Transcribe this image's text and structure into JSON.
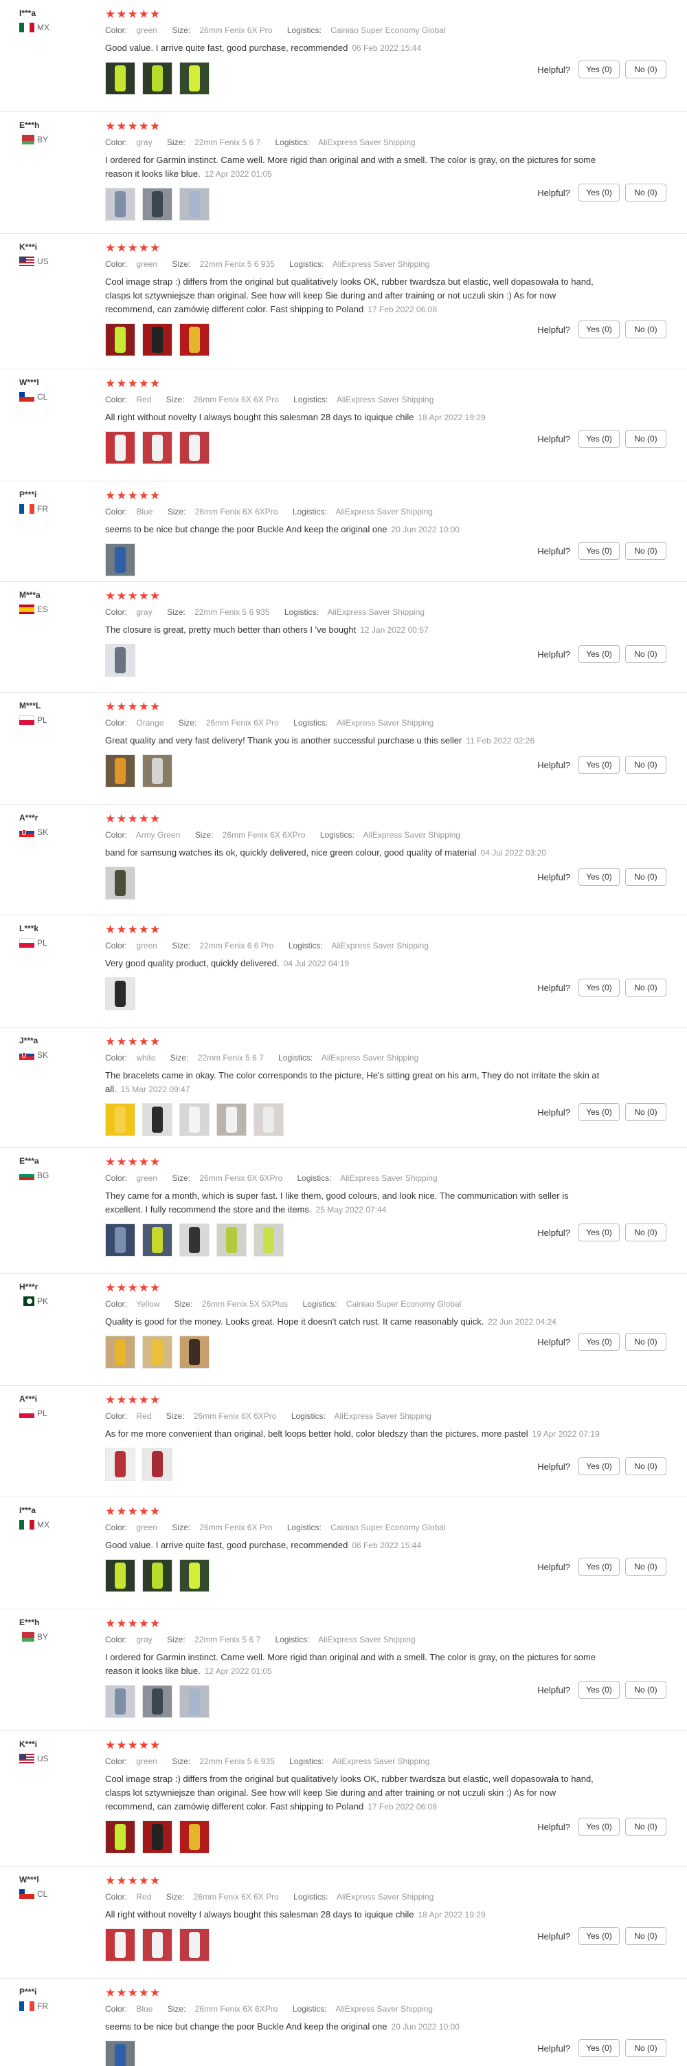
{
  "labels": {
    "color": "Color:",
    "size": "Size:",
    "logistics": "Logistics:",
    "helpful": "Helpful?",
    "yes": "Yes (0)",
    "no": "No (0)"
  },
  "reviews": [
    {
      "name": "I***a",
      "country": "MX",
      "stars": "★★★★★",
      "color": "green",
      "size": "26mm Fenix 6X Pro",
      "logistics": "Cainiao Super Economy Global",
      "text": "Good value. I arrive quite fast, good purchase, recommended",
      "date": "06 Feb 2022 15:44",
      "images": [
        "#2c3a28",
        "#2e3d27",
        "#334a2c"
      ],
      "image_fills": [
        "#c5e531",
        "#b8dc2b",
        "#d4ee3a"
      ]
    },
    {
      "name": "E***h",
      "country": "BY",
      "stars": "★★★★★",
      "color": "gray",
      "size": "22mm Fenix 5 6 7",
      "logistics": "AliExpress Saver Shipping",
      "text": "I ordered for Garmin instinct. Came well. More rigid than original and with a smell. The color is gray, on the pictures for some reason it looks like blue.",
      "date": "12 Apr 2022 01:05",
      "images": [
        "#c9ccd3",
        "#8b8f97",
        "#b7bcc6"
      ],
      "image_fills": [
        "#7d8ea6",
        "#3c4650",
        "#a4b5cc"
      ]
    },
    {
      "name": "K***i",
      "country": "US",
      "stars": "★★★★★",
      "color": "green",
      "size": "22mm Fenix 5 6 935",
      "logistics": "AliExpress Saver Shipping",
      "text": "Cool image strap :) differs from the original but qualitatively looks OK, rubber twardsza but elastic, well dopasowała to hand, clasps lot sztywniejsze than original. See how will keep Sie during and after training or not uczuli skin :) As for now recommend, can zamówię different color. Fast shipping to Poland",
      "date": "17 Feb 2022 06:08",
      "images": [
        "#8c1b1b",
        "#a01818",
        "#b31a1a"
      ],
      "image_fills": [
        "#c6ea2f",
        "#222222",
        "#e5b52a"
      ]
    },
    {
      "name": "W***l",
      "country": "CL",
      "stars": "★★★★★",
      "color": "Red",
      "size": "26mm Fenix 6X 6X Pro",
      "logistics": "AliExpress Saver Shipping",
      "text": "All right without novelty I always bought this salesman 28 days to iquique chile",
      "date": "18 Apr 2022 19:29",
      "images": [
        "#c4343c",
        "#c13a40",
        "#be3a42"
      ],
      "image_fills": [
        "#f2f2f2",
        "#f2f2f2",
        "#f2f2f2"
      ]
    },
    {
      "name": "P***i",
      "country": "FR",
      "stars": "★★★★★",
      "color": "Blue",
      "size": "26mm Fenix 6X 6XPro",
      "logistics": "AliExpress Saver Shipping",
      "text": "seems to be nice but change the poor Buckle And keep the original one",
      "date": "20 Jun 2022 10:00",
      "images": [
        "#6e7a84"
      ],
      "image_fills": [
        "#2f5fa8"
      ]
    },
    {
      "name": "M***a",
      "country": "ES",
      "stars": "★★★★★",
      "color": "gray",
      "size": "22mm Fenix 5 6 935",
      "logistics": "AliExpress Saver Shipping",
      "text": "The closure is great, pretty much better than others I 've bought",
      "date": "12 Jan 2022 00:57",
      "images": [
        "#dfe2e6"
      ],
      "image_fills": [
        "#6b7380"
      ]
    },
    {
      "name": "M***L",
      "country": "PL",
      "stars": "★★★★★",
      "color": "Orange",
      "size": "26mm Fenix 6X Pro",
      "logistics": "AliExpress Saver Shipping",
      "text": "Great quality and very fast delivery! Thank you is another successful purchase u this seller",
      "date": "11 Feb 2022 02:26",
      "images": [
        "#6b5a40",
        "#8a7b66"
      ],
      "image_fills": [
        "#e0952a",
        "#d3d3cf"
      ]
    },
    {
      "name": "A***r",
      "country": "SK",
      "stars": "★★★★★",
      "color": "Army Green",
      "size": "26mm Fenix 6X 6XPro",
      "logistics": "AliExpress Saver Shipping",
      "text": "band for samsung watches its ok, quickly delivered, nice green colour, good quality of material",
      "date": "04 Jul 2022 03:20",
      "images": [
        "#cfcfcf"
      ],
      "image_fills": [
        "#4b4f3a"
      ]
    },
    {
      "name": "L***k",
      "country": "PL",
      "stars": "★★★★★",
      "color": "green",
      "size": "22mm Fenix 6 6 Pro",
      "logistics": "AliExpress Saver Shipping",
      "text": "Very good quality product, quickly delivered.",
      "date": "04 Jul 2022 04:19",
      "images": [
        "#e6e6e6"
      ],
      "image_fills": [
        "#2a2a2a"
      ]
    },
    {
      "name": "J***a",
      "country": "SK",
      "stars": "★★★★★",
      "color": "white",
      "size": "22mm Fenix 5 6 7",
      "logistics": "AliExpress Saver Shipping",
      "text": "The bracelets came in okay. The color corresponds to the picture, He's sitting great on his arm, They do not irritate the skin at all.",
      "date": "15 Mar 2022 09:47",
      "images": [
        "#f0c419",
        "#dedede",
        "#d6d6d6",
        "#b9b4ae",
        "#d9d4cf"
      ],
      "image_fills": [
        "#f5d04a",
        "#2b2b2b",
        "#f4f4f4",
        "#f2f2f2",
        "#ececec"
      ]
    },
    {
      "name": "E***a",
      "country": "BG",
      "stars": "★★★★★",
      "color": "green",
      "size": "26mm Fenix 6X 6XPro",
      "logistics": "AliExpress Saver Shipping",
      "text": "They came for a month, which is super fast. I like them, good colours, and look nice. The communication with seller is excellent. I fully recommend the store and the items.",
      "date": "25 May 2022 07:44",
      "images": [
        "#3a4a6a",
        "#4a5a74",
        "#d8d8d8",
        "#cfd2c8",
        "#d2d4cc"
      ],
      "image_fills": [
        "#7a8fb0",
        "#c8d82a",
        "#333333",
        "#b5c93c",
        "#c8e04a"
      ]
    },
    {
      "name": "H***r",
      "country": "PK",
      "stars": "★★★★★",
      "color": "Yellow",
      "size": "26mm Fenix 5X 5XPlus",
      "logistics": "Cainiao Super Economy Global",
      "text": "Quality is good for the money. Looks great. Hope it doesn't catch rust. It came reasonably quick.",
      "date": "22 Jun 2022 04:24",
      "images": [
        "#c9a878",
        "#d4b888",
        "#c79f6c"
      ],
      "image_fills": [
        "#e6b52a",
        "#e9c03a",
        "#3a2e22"
      ]
    },
    {
      "name": "A***i",
      "country": "PL",
      "stars": "★★★★★",
      "color": "Red",
      "size": "26mm Fenix 6X 6XPro",
      "logistics": "AliExpress Saver Shipping",
      "text": "As for me more convenient than original, belt loops better hold, color bledszy than the pictures, more pastel",
      "date": "19 Apr 2022 07:19",
      "images": [
        "#eeeeee",
        "#e8e8e8"
      ],
      "image_fills": [
        "#b8303a",
        "#a82a34"
      ]
    },
    {
      "name": "I***a",
      "country": "MX",
      "stars": "★★★★★",
      "color": "green",
      "size": "26mm Fenix 6X Pro",
      "logistics": "Cainiao Super Economy Global",
      "text": "Good value. I arrive quite fast, good purchase, recommended",
      "date": "06 Feb 2022 15:44",
      "images": [
        "#2c3a28",
        "#2e3d27",
        "#334a2c"
      ],
      "image_fills": [
        "#c5e531",
        "#b8dc2b",
        "#d4ee3a"
      ]
    },
    {
      "name": "E***h",
      "country": "BY",
      "stars": "★★★★★",
      "color": "gray",
      "size": "22mm Fenix 5 6 7",
      "logistics": "AliExpress Saver Shipping",
      "text": "I ordered for Garmin instinct. Came well. More rigid than original and with a smell. The color is gray, on the pictures for some reason it looks like blue.",
      "date": "12 Apr 2022 01:05",
      "images": [
        "#c9ccd3",
        "#8b8f97",
        "#b7bcc6"
      ],
      "image_fills": [
        "#7d8ea6",
        "#3c4650",
        "#a4b5cc"
      ]
    },
    {
      "name": "K***i",
      "country": "US",
      "stars": "★★★★★",
      "color": "green",
      "size": "22mm Fenix 5 6 935",
      "logistics": "AliExpress Saver Shipping",
      "text": "Cool image strap :) differs from the original but qualitatively looks OK, rubber twardsza but elastic, well dopasowała to hand, clasps lot sztywniejsze than original. See how will keep Sie during and after training or not uczuli skin :) As for now recommend, can zamówię different color. Fast shipping to Poland",
      "date": "17 Feb 2022 06:08",
      "images": [
        "#8c1b1b",
        "#a01818",
        "#b31a1a"
      ],
      "image_fills": [
        "#c6ea2f",
        "#222222",
        "#e5b52a"
      ]
    },
    {
      "name": "W***l",
      "country": "CL",
      "stars": "★★★★★",
      "color": "Red",
      "size": "26mm Fenix 6X 6X Pro",
      "logistics": "AliExpress Saver Shipping",
      "text": "All right without novelty I always bought this salesman 28 days to iquique chile",
      "date": "18 Apr 2022 19:29",
      "images": [
        "#c4343c",
        "#c13a40",
        "#be3a42"
      ],
      "image_fills": [
        "#f2f2f2",
        "#f2f2f2",
        "#f2f2f2"
      ]
    },
    {
      "name": "P***i",
      "country": "FR",
      "stars": "★★★★★",
      "color": "Blue",
      "size": "26mm Fenix 6X 6XPro",
      "logistics": "AliExpress Saver Shipping",
      "text": "seems to be nice but change the poor Buckle And keep the original one",
      "date": "20 Jun 2022 10:00",
      "images": [
        "#6e7a84"
      ],
      "image_fills": [
        "#2f5fa8"
      ]
    }
  ]
}
